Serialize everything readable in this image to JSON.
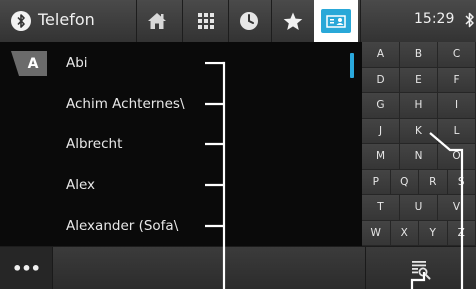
{
  "header": {
    "title": "Telefon",
    "time": "15:29",
    "nav": [
      {
        "name": "home-icon"
      },
      {
        "name": "keypad-icon"
      },
      {
        "name": "recent-calls-icon"
      },
      {
        "name": "favorites-icon"
      },
      {
        "name": "contacts-icon",
        "active": true
      }
    ]
  },
  "list": {
    "index_letter": "A",
    "contacts": [
      "Abi",
      "Achim Achternes\\",
      "Albrecht",
      "Alex",
      "Alexander (Sofa\\"
    ]
  },
  "keyboard": {
    "rows": [
      [
        "A",
        "B",
        "C"
      ],
      [
        "D",
        "E",
        "F"
      ],
      [
        "G",
        "H",
        "I"
      ],
      [
        "J",
        "K",
        "L"
      ],
      [
        "M",
        "N",
        "O"
      ],
      [
        "P",
        "Q",
        "R",
        "S"
      ],
      [
        "T",
        "U",
        "V"
      ],
      [
        "W",
        "X",
        "Y",
        "Z"
      ]
    ]
  },
  "footer": {
    "more_label": "•••",
    "search_icon": "contact-search-icon"
  },
  "colors": {
    "accent": "#29a8d8",
    "background": "#101010",
    "bar": "#3a3a3a"
  }
}
